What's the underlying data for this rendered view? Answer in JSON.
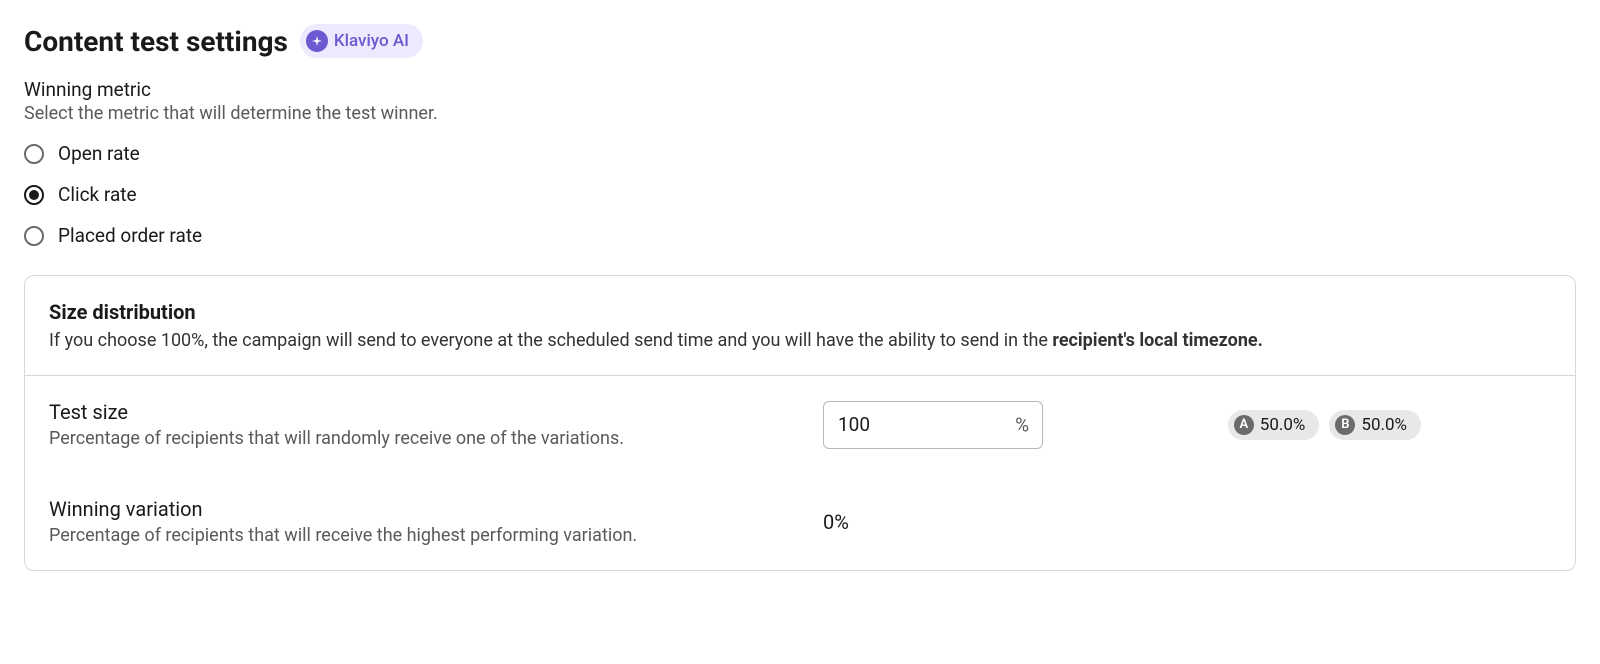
{
  "header": {
    "title": "Content test settings",
    "ai_badge": "Klaviyo AI"
  },
  "winning_metric": {
    "label": "Winning metric",
    "sub": "Select the metric that will determine the test winner.",
    "options": [
      {
        "label": "Open rate",
        "selected": false
      },
      {
        "label": "Click rate",
        "selected": true
      },
      {
        "label": "Placed order rate",
        "selected": false
      }
    ]
  },
  "size_distribution": {
    "title": "Size distribution",
    "desc_prefix": "If you choose 100%, the campaign will send to everyone at the scheduled send time and you will have the ability to send in the ",
    "desc_bold": "recipient's local timezone."
  },
  "test_size": {
    "title": "Test size",
    "desc": "Percentage of recipients that will randomly receive one of the variations.",
    "value": "100",
    "suffix": "%",
    "pills": [
      {
        "badge": "A",
        "value": "50.0%"
      },
      {
        "badge": "B",
        "value": "50.0%"
      }
    ]
  },
  "winning_variation": {
    "title": "Winning variation",
    "desc": "Percentage of recipients that will receive the highest performing variation.",
    "value": "0%"
  }
}
